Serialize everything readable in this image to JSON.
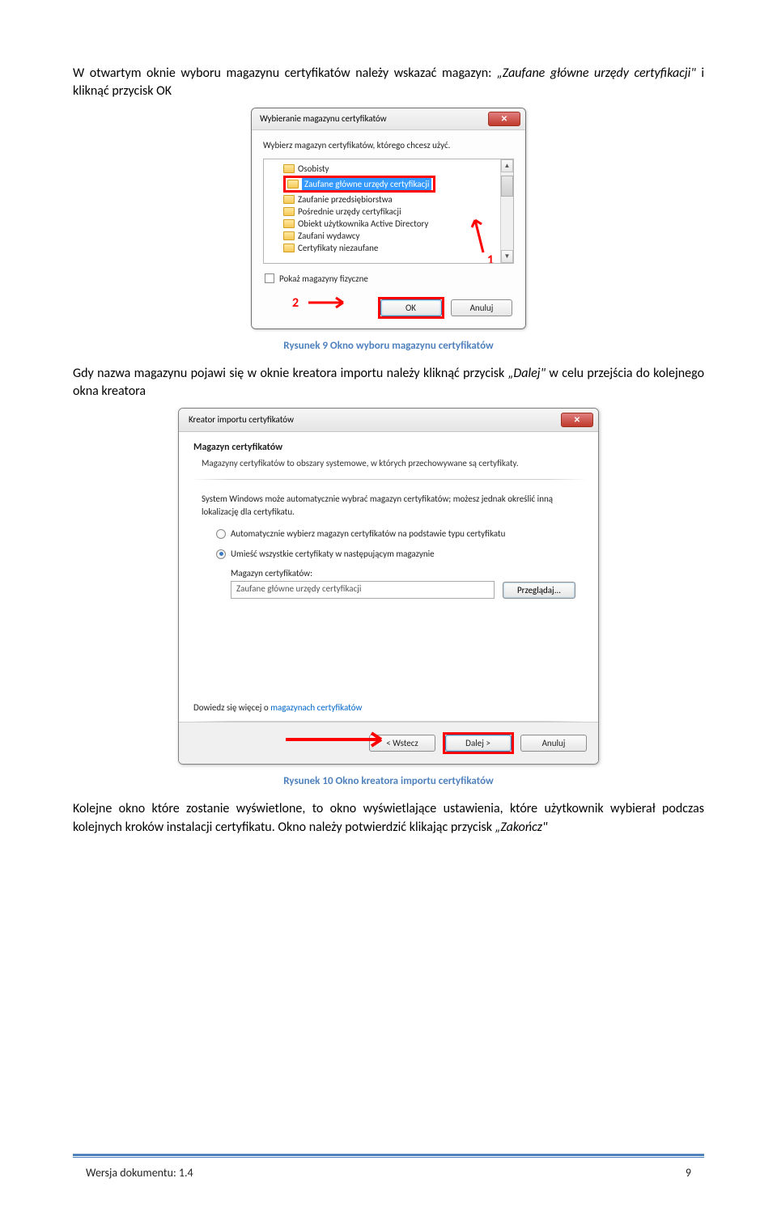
{
  "intro_text": "W otwartym oknie wyboru magazynu certyfikatów należy wskazać magazyn: ",
  "intro_italic": "„Zaufane główne urzędy certyfikacji\"",
  "intro_text2": " i kliknąć przycisk OK",
  "dialog1": {
    "title": "Wybieranie magazynu certyfikatów",
    "instruction": "Wybierz magazyn certyfikatów, którego chcesz użyć.",
    "items": [
      "Osobisty",
      "Zaufane główne urzędy certyfikacji",
      "Zaufanie przedsiębiorstwa",
      "Pośrednie urzędy certyfikacji",
      "Obiekt użytkownika Active Directory",
      "Zaufani wydawcy",
      "Certyfikaty niezaufane"
    ],
    "checkbox_label": "Pokaż magazyny fizyczne",
    "ok_label": "OK",
    "cancel_label": "Anuluj",
    "marker1": "1",
    "marker2": "2"
  },
  "caption1": "Rysunek 9 Okno wyboru magazynu certyfikatów",
  "para2_a": "Gdy nazwa magazynu pojawi się w oknie kreatora importu należy kliknąć przycisk ",
  "para2_italic": "„Dalej\"",
  "para2_b": " w celu przejścia do kolejnego okna kreatora",
  "dialog2": {
    "title": "Kreator importu certyfikatów",
    "section_head": "Magazyn certyfikatów",
    "section_sub": "Magazyny certyfikatów to obszary systemowe, w których przechowywane są certyfikaty.",
    "body_text": "System Windows może automatycznie wybrać magazyn certyfikatów; możesz jednak określić inną lokalizację dla certyfikatu.",
    "radio1": "Automatycznie wybierz magazyn certyfikatów na podstawie typu certyfikatu",
    "radio2": "Umieść wszystkie certyfikaty w następującym magazynie",
    "mag_label": "Magazyn certyfikatów:",
    "mag_value": "Zaufane główne urzędy certyfikacji",
    "browse_label": "Przeglądaj...",
    "link_prefix": "Dowiedz się więcej o ",
    "link_text": "magazynach certyfikatów",
    "back_label": "< Wstecz",
    "next_label": "Dalej >",
    "cancel_label": "Anuluj"
  },
  "caption2": "Rysunek 10 Okno kreatora importu certyfikatów",
  "para3": "Kolejne okno które zostanie wyświetlone, to okno wyświetlające ustawienia, które użytkownik wybierał podczas kolejnych kroków instalacji certyfikatu. Okno należy potwierdzić klikając przycisk ",
  "para3_italic": "„Zakończ\"",
  "footer": {
    "version": "Wersja dokumentu: 1.4",
    "page": "9"
  }
}
